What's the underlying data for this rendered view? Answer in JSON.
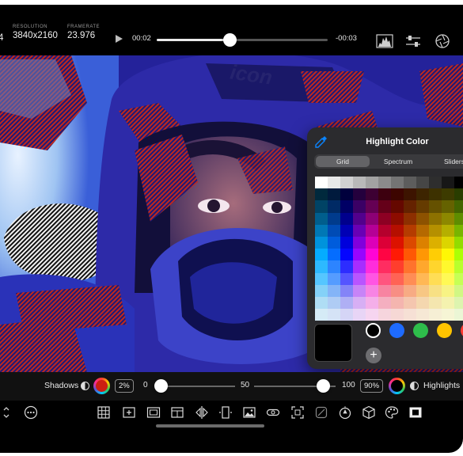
{
  "top_bar": {
    "frame_partial": "4",
    "resolution_label": "RESOLUTION",
    "resolution_value": "3840x2160",
    "framerate_label": "FRAMERATE",
    "framerate_value": "23.976",
    "elapsed_time": "00:02",
    "remaining_time": "-00:03",
    "playback_progress": 0.43,
    "icons": [
      "play-icon",
      "histogram-icon",
      "levels-icon",
      "aperture-icon"
    ]
  },
  "popover": {
    "title": "Highlight Color",
    "tabs": [
      {
        "label": "Grid",
        "active": true
      },
      {
        "label": "Spectrum",
        "active": false
      },
      {
        "label": "Sliders",
        "active": false
      }
    ],
    "current_color": "#000000",
    "swatches": [
      "#000000",
      "#1e6bff",
      "#2ebd4b",
      "#ffc400",
      "#ff3b30"
    ],
    "add_label": "+"
  },
  "adjustment_bar": {
    "shadows_label": "Shadows",
    "shadows_color": "#cc1e12",
    "shadows_percent": "2%",
    "range_min": "0",
    "range_mid": "50",
    "range_max": "100",
    "lower_value": 0,
    "upper_value": 100,
    "highlights_percent": "90%",
    "highlights_label": "Highlights",
    "highlights_color": "#000000"
  },
  "bottom_toolbar": {
    "tools": [
      "stepper-icon",
      "more-icon",
      "grid-overlay-icon",
      "add-frame-icon",
      "safe-area-icon",
      "crop-icon",
      "flip-icon",
      "split-icon",
      "image-icon",
      "link-icon",
      "focus-icon",
      "false-color-icon",
      "compass-icon",
      "cube-icon",
      "palette-icon",
      "zebra-icon"
    ]
  }
}
